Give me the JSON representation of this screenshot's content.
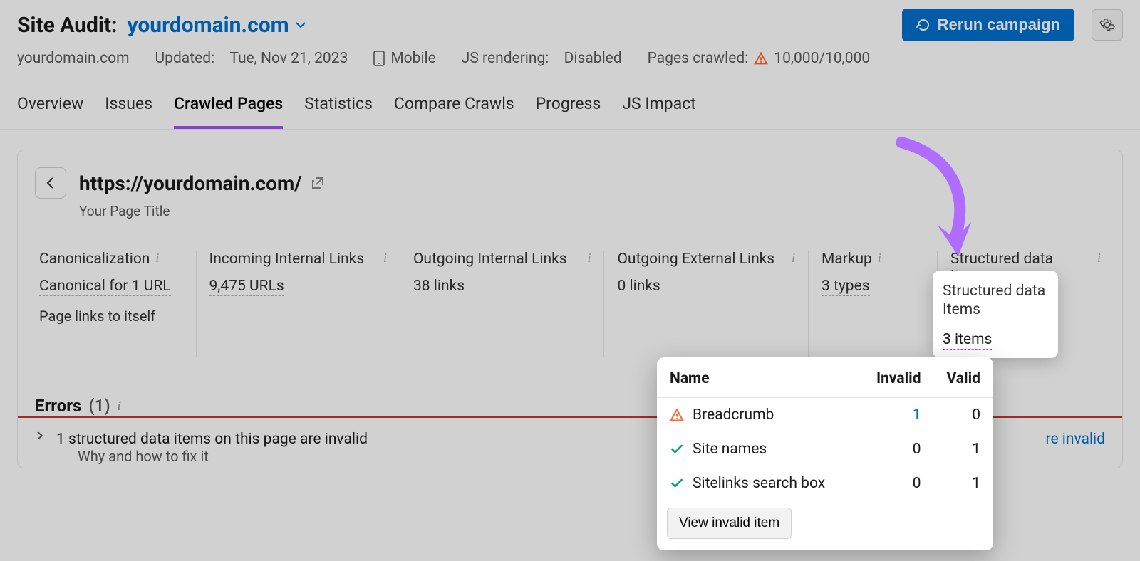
{
  "header": {
    "tool_label": "Site Audit:",
    "domain": "yourdomain.com",
    "rerun_label": "Rerun campaign"
  },
  "meta": {
    "domain": "yourdomain.com",
    "updated_label": "Updated:",
    "updated_value": "Tue, Nov 21, 2023",
    "device": "Mobile",
    "js_rendering_label": "JS rendering:",
    "js_rendering_value": "Disabled",
    "pages_crawled_label": "Pages crawled:",
    "pages_crawled_value": "10,000/10,000"
  },
  "tabs": [
    {
      "label": "Overview"
    },
    {
      "label": "Issues"
    },
    {
      "label": "Crawled Pages",
      "active": true
    },
    {
      "label": "Statistics"
    },
    {
      "label": "Compare Crawls"
    },
    {
      "label": "Progress"
    },
    {
      "label": "JS Impact"
    }
  ],
  "page": {
    "url": "https://yourdomain.com/",
    "title": "Your Page Title"
  },
  "stats": {
    "canonicalization": {
      "label": "Canonicalization",
      "value": "Canonical for 1 URL",
      "extra": "Page links to itself"
    },
    "incoming_internal": {
      "label": "Incoming Internal Links",
      "value": "9,475 URLs"
    },
    "outgoing_internal": {
      "label": "Outgoing Internal Links",
      "value": "38 links"
    },
    "outgoing_external": {
      "label": "Outgoing External Links",
      "value": "0 links"
    },
    "markup": {
      "label": "Markup",
      "value": "3 types"
    },
    "structured_data": {
      "label": "Structured data Items",
      "value": "3 items"
    }
  },
  "errors": {
    "title": "Errors",
    "count": "(1)",
    "item_text": "1 structured data items on this page are invalid",
    "why_text": "Why and how to fix it",
    "right_link_suffix": "re invalid"
  },
  "popover": {
    "columns": {
      "name": "Name",
      "invalid": "Invalid",
      "valid": "Valid"
    },
    "rows": [
      {
        "status": "warn",
        "name": "Breadcrumb",
        "invalid": "1",
        "valid": "0"
      },
      {
        "status": "ok",
        "name": "Site names",
        "invalid": "0",
        "valid": "1"
      },
      {
        "status": "ok",
        "name": "Sitelinks search box",
        "invalid": "0",
        "valid": "1"
      }
    ],
    "button": "View invalid item"
  }
}
